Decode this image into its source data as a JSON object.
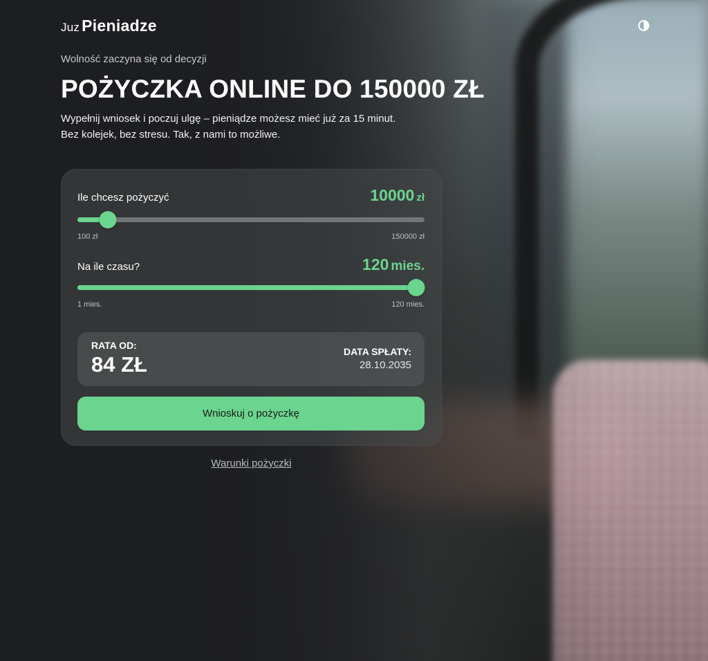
{
  "header": {
    "logo_light": "Juz",
    "logo_bold": "Pieniadze",
    "theme_toggle_icon": "contrast-icon"
  },
  "hero": {
    "tagline": "Wolność zaczyna się od decyzji",
    "headline": "POŻYCZKA ONLINE DO 150000 ZŁ",
    "description_line1": "Wypełnij wniosek i poczuj ulgę – pieniądze możesz mieć już za 15 minut.",
    "description_line2": "Bez kolejek, bez stresu. Tak, z nami to możliwe."
  },
  "calculator": {
    "amount": {
      "label": "Ile chcesz pożyczyć",
      "value": "10000",
      "unit": "zł",
      "min_label": "100 zł",
      "max_label": "150000 zł",
      "min": 100,
      "max": 150000,
      "current": 10000
    },
    "period": {
      "label": "Na ile czasu?",
      "value": "120",
      "unit": "mies.",
      "min_label": "1 mies.",
      "max_label": "120 mies.",
      "min": 1,
      "max": 120,
      "current": 120
    },
    "summary": {
      "rata_label": "RATA OD:",
      "rata_value": "84 ZŁ",
      "date_label": "DATA SPŁATY:",
      "date_value": "28.10.2035"
    },
    "apply_button": "Wnioskuj o pożyczkę"
  },
  "footer": {
    "terms_link": "Warunki pożyczki"
  },
  "colors": {
    "accent": "#6bd48e",
    "background": "#1d1e21",
    "card": "#3f4143"
  }
}
